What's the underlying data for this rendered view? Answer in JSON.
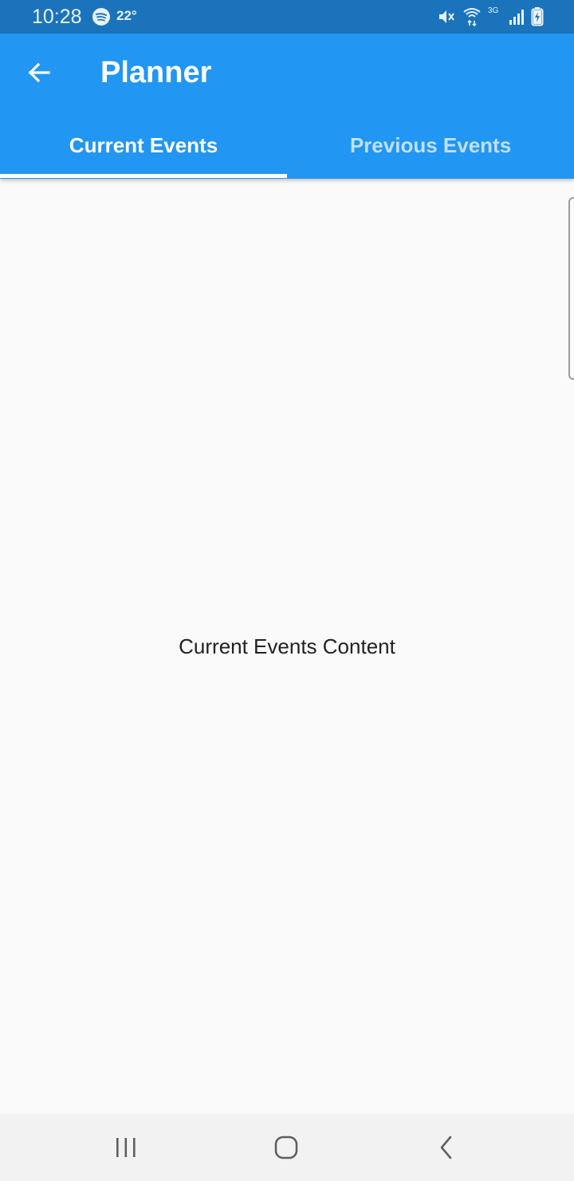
{
  "status_bar": {
    "time": "10:28",
    "temperature": "22°",
    "network": "3G",
    "icons": [
      "spotify-icon",
      "mute-icon",
      "wifi-icon",
      "signal-icon",
      "battery-charging-icon"
    ]
  },
  "app_bar": {
    "title": "Planner",
    "back_icon": "arrow-left-icon"
  },
  "tabs": [
    {
      "label": "Current Events",
      "selected": true
    },
    {
      "label": "Previous Events",
      "selected": false
    }
  ],
  "content": {
    "text": "Current Events Content"
  },
  "nav_bar": {
    "icons": [
      "recent-apps-icon",
      "home-icon",
      "back-icon"
    ]
  },
  "colors": {
    "status_bar": "#1b74bb",
    "app_bar": "#2196f3",
    "tab_selected_text": "#ffffff",
    "tab_unselected_text": "#bfe0fb",
    "background": "#fafafa",
    "nav_bar": "#f2f2f2"
  }
}
